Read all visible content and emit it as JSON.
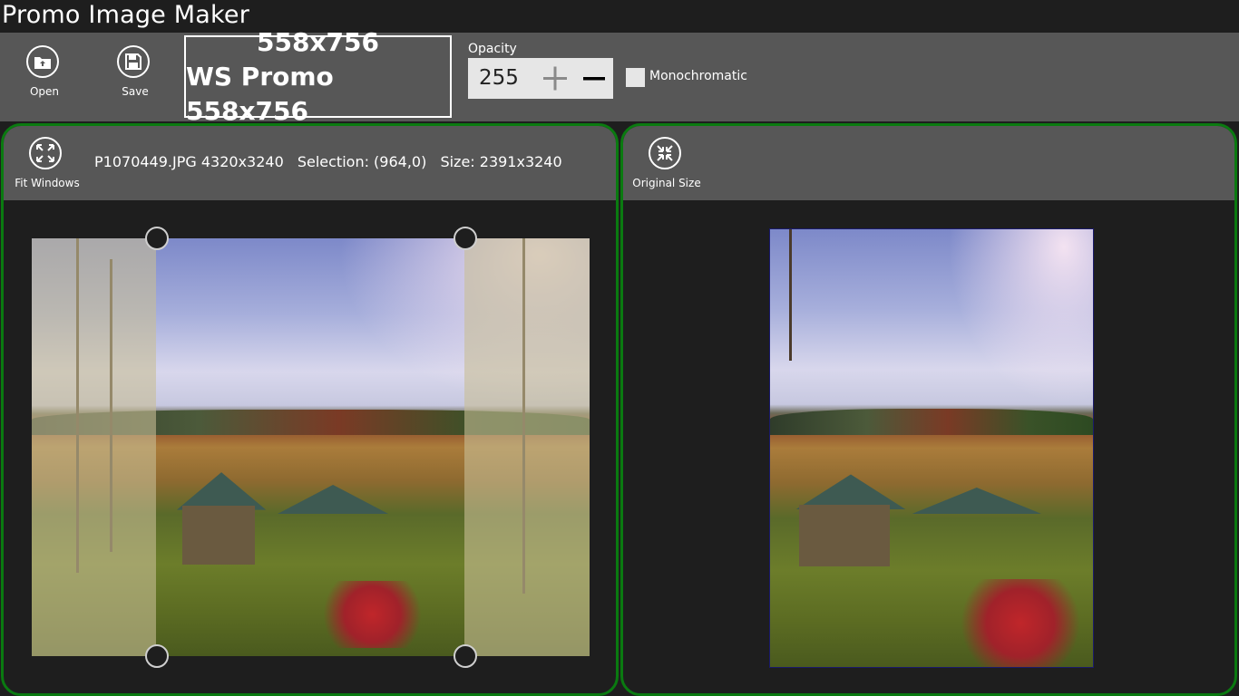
{
  "app": {
    "title": "Promo Image Maker"
  },
  "toolbar": {
    "open_label": "Open",
    "save_label": "Save",
    "preset_size": "558x756",
    "preset_name": "WS Promo 558x756",
    "opacity_label": "Opacity",
    "opacity_value": "255",
    "monochromatic_label": "Monochromatic",
    "monochromatic_checked": false
  },
  "left_panel": {
    "fit_label": "Fit Windows",
    "file_info": "P1070449.JPG 4320x3240",
    "selection_info": "Selection: (964,0)",
    "size_info": "Size: 2391x3240"
  },
  "right_panel": {
    "original_label": "Original Size"
  },
  "colors": {
    "panel_border": "#0a7a10",
    "toolbar_bg": "#575757",
    "app_bg": "#1e1e1e"
  }
}
